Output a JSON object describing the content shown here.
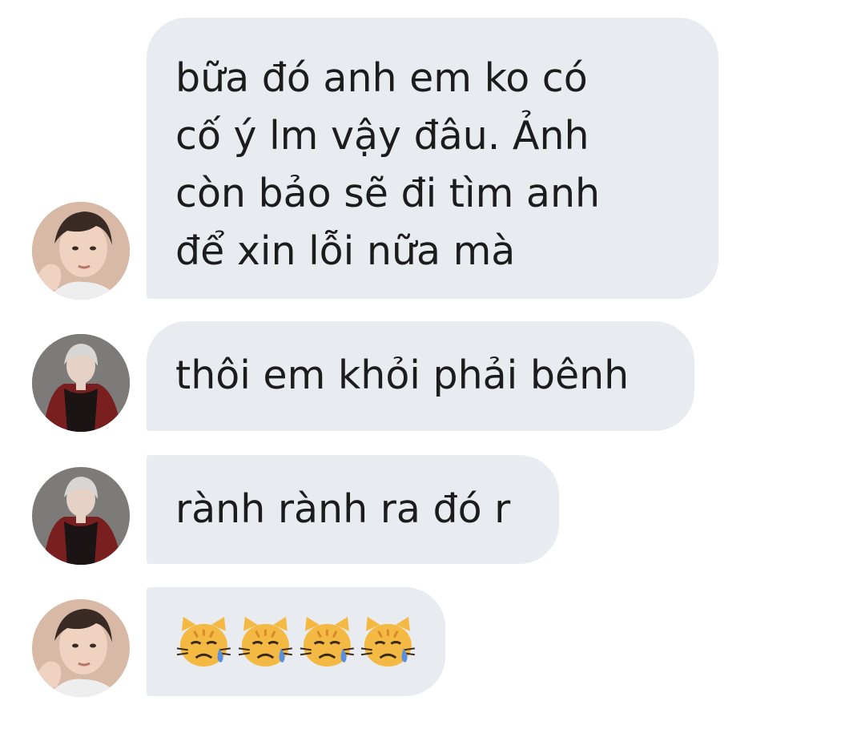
{
  "messages": [
    {
      "lines": [
        "bữa đó anh em ko có",
        "cố ý lm vậy đâu. Ảnh",
        "còn bảo sẽ đi tìm anh",
        "để xin lỗi nữa mà"
      ],
      "avatar": "avatar-brown-hair-icon"
    },
    {
      "text": "thôi em khỏi phải bênh",
      "avatar": "avatar-silver-hair-icon"
    },
    {
      "text": "rành rành ra đó r",
      "avatar": "avatar-silver-hair-icon"
    },
    {
      "emojis": [
        "crying-cat-icon",
        "crying-cat-icon",
        "crying-cat-icon",
        "crying-cat-icon"
      ],
      "avatar": "avatar-brown-hair-icon"
    }
  ],
  "colors": {
    "bubble": "#e8ebef",
    "text": "#1c1c1c",
    "background": "#ffffff"
  }
}
